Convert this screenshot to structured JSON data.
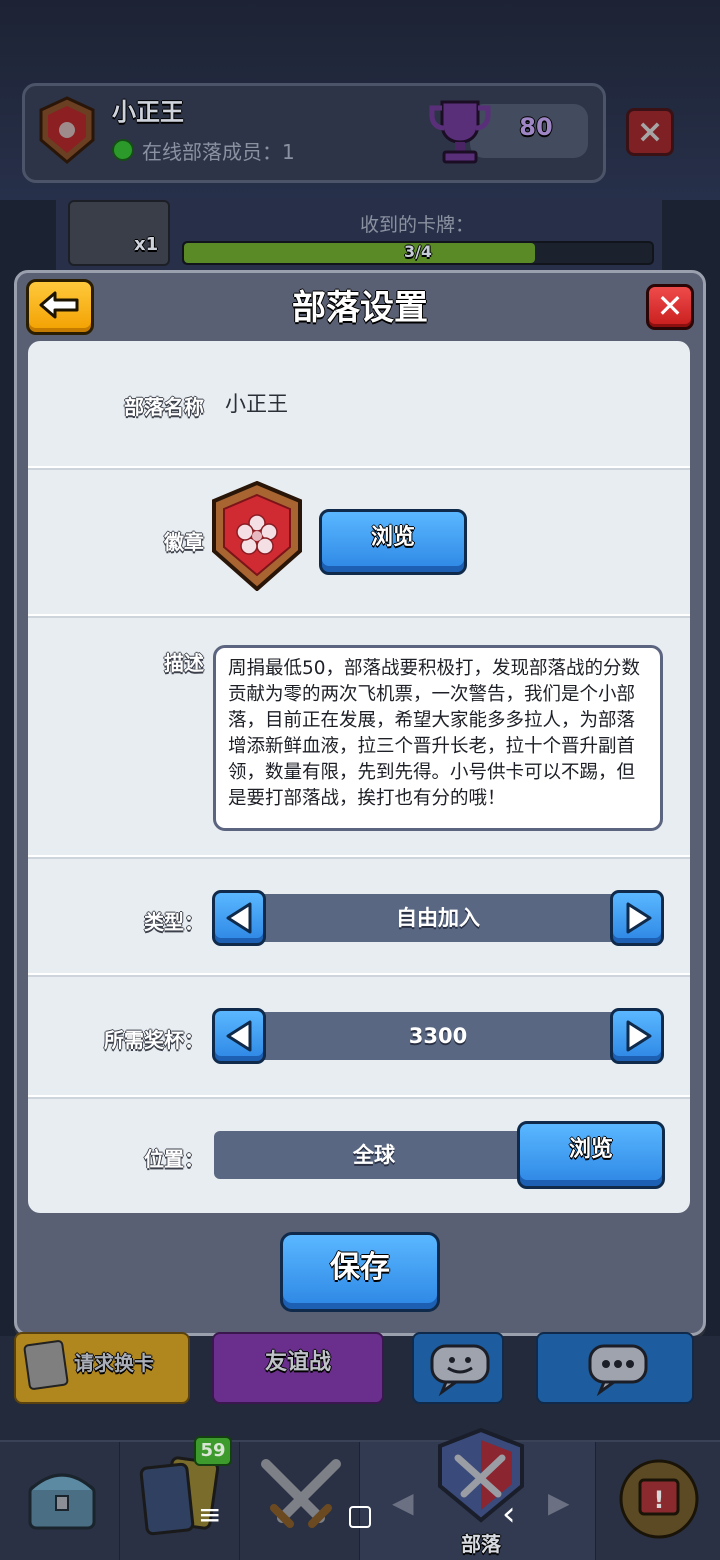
{
  "background": {
    "clan_name": "小正王",
    "online_text": "在线部落成员：1",
    "trophies": "80",
    "card_count": "x1",
    "received_label": "收到的卡牌：",
    "received_progress": "3/4",
    "received_fraction": 0.75,
    "bottom_buttons": {
      "request_card": "请求换卡",
      "friendly_battle": "友谊战"
    },
    "nav": {
      "cards_badge": "59",
      "clan_label": "部落"
    }
  },
  "modal": {
    "title": "部落设置",
    "fields": {
      "name_label": "部落名称",
      "name_value": "小正王",
      "badge_label": "徽章",
      "badge_browse": "浏览",
      "desc_label": "描述",
      "desc_value": "周捐最低50，部落战要积极打，发现部落战的分数贡献为零的两次飞机票，一次警告，我们是个小部落，目前正在发展，希望大家能多多拉人，为部落增添新鲜血液，拉三个晋升长老，拉十个晋升副首领，数量有限，先到先得。小号供卡可以不踢，但是要打部落战，挨打也有分的哦！",
      "type_label": "类型：",
      "type_value": "自由加入",
      "trophy_label": "所需奖杯：",
      "trophy_value": "3300",
      "location_label": "位置：",
      "location_value": "全球",
      "location_browse": "浏览"
    },
    "save_label": "保存"
  },
  "system_nav": {
    "menu": "≡",
    "home": "□",
    "back": "‹"
  }
}
